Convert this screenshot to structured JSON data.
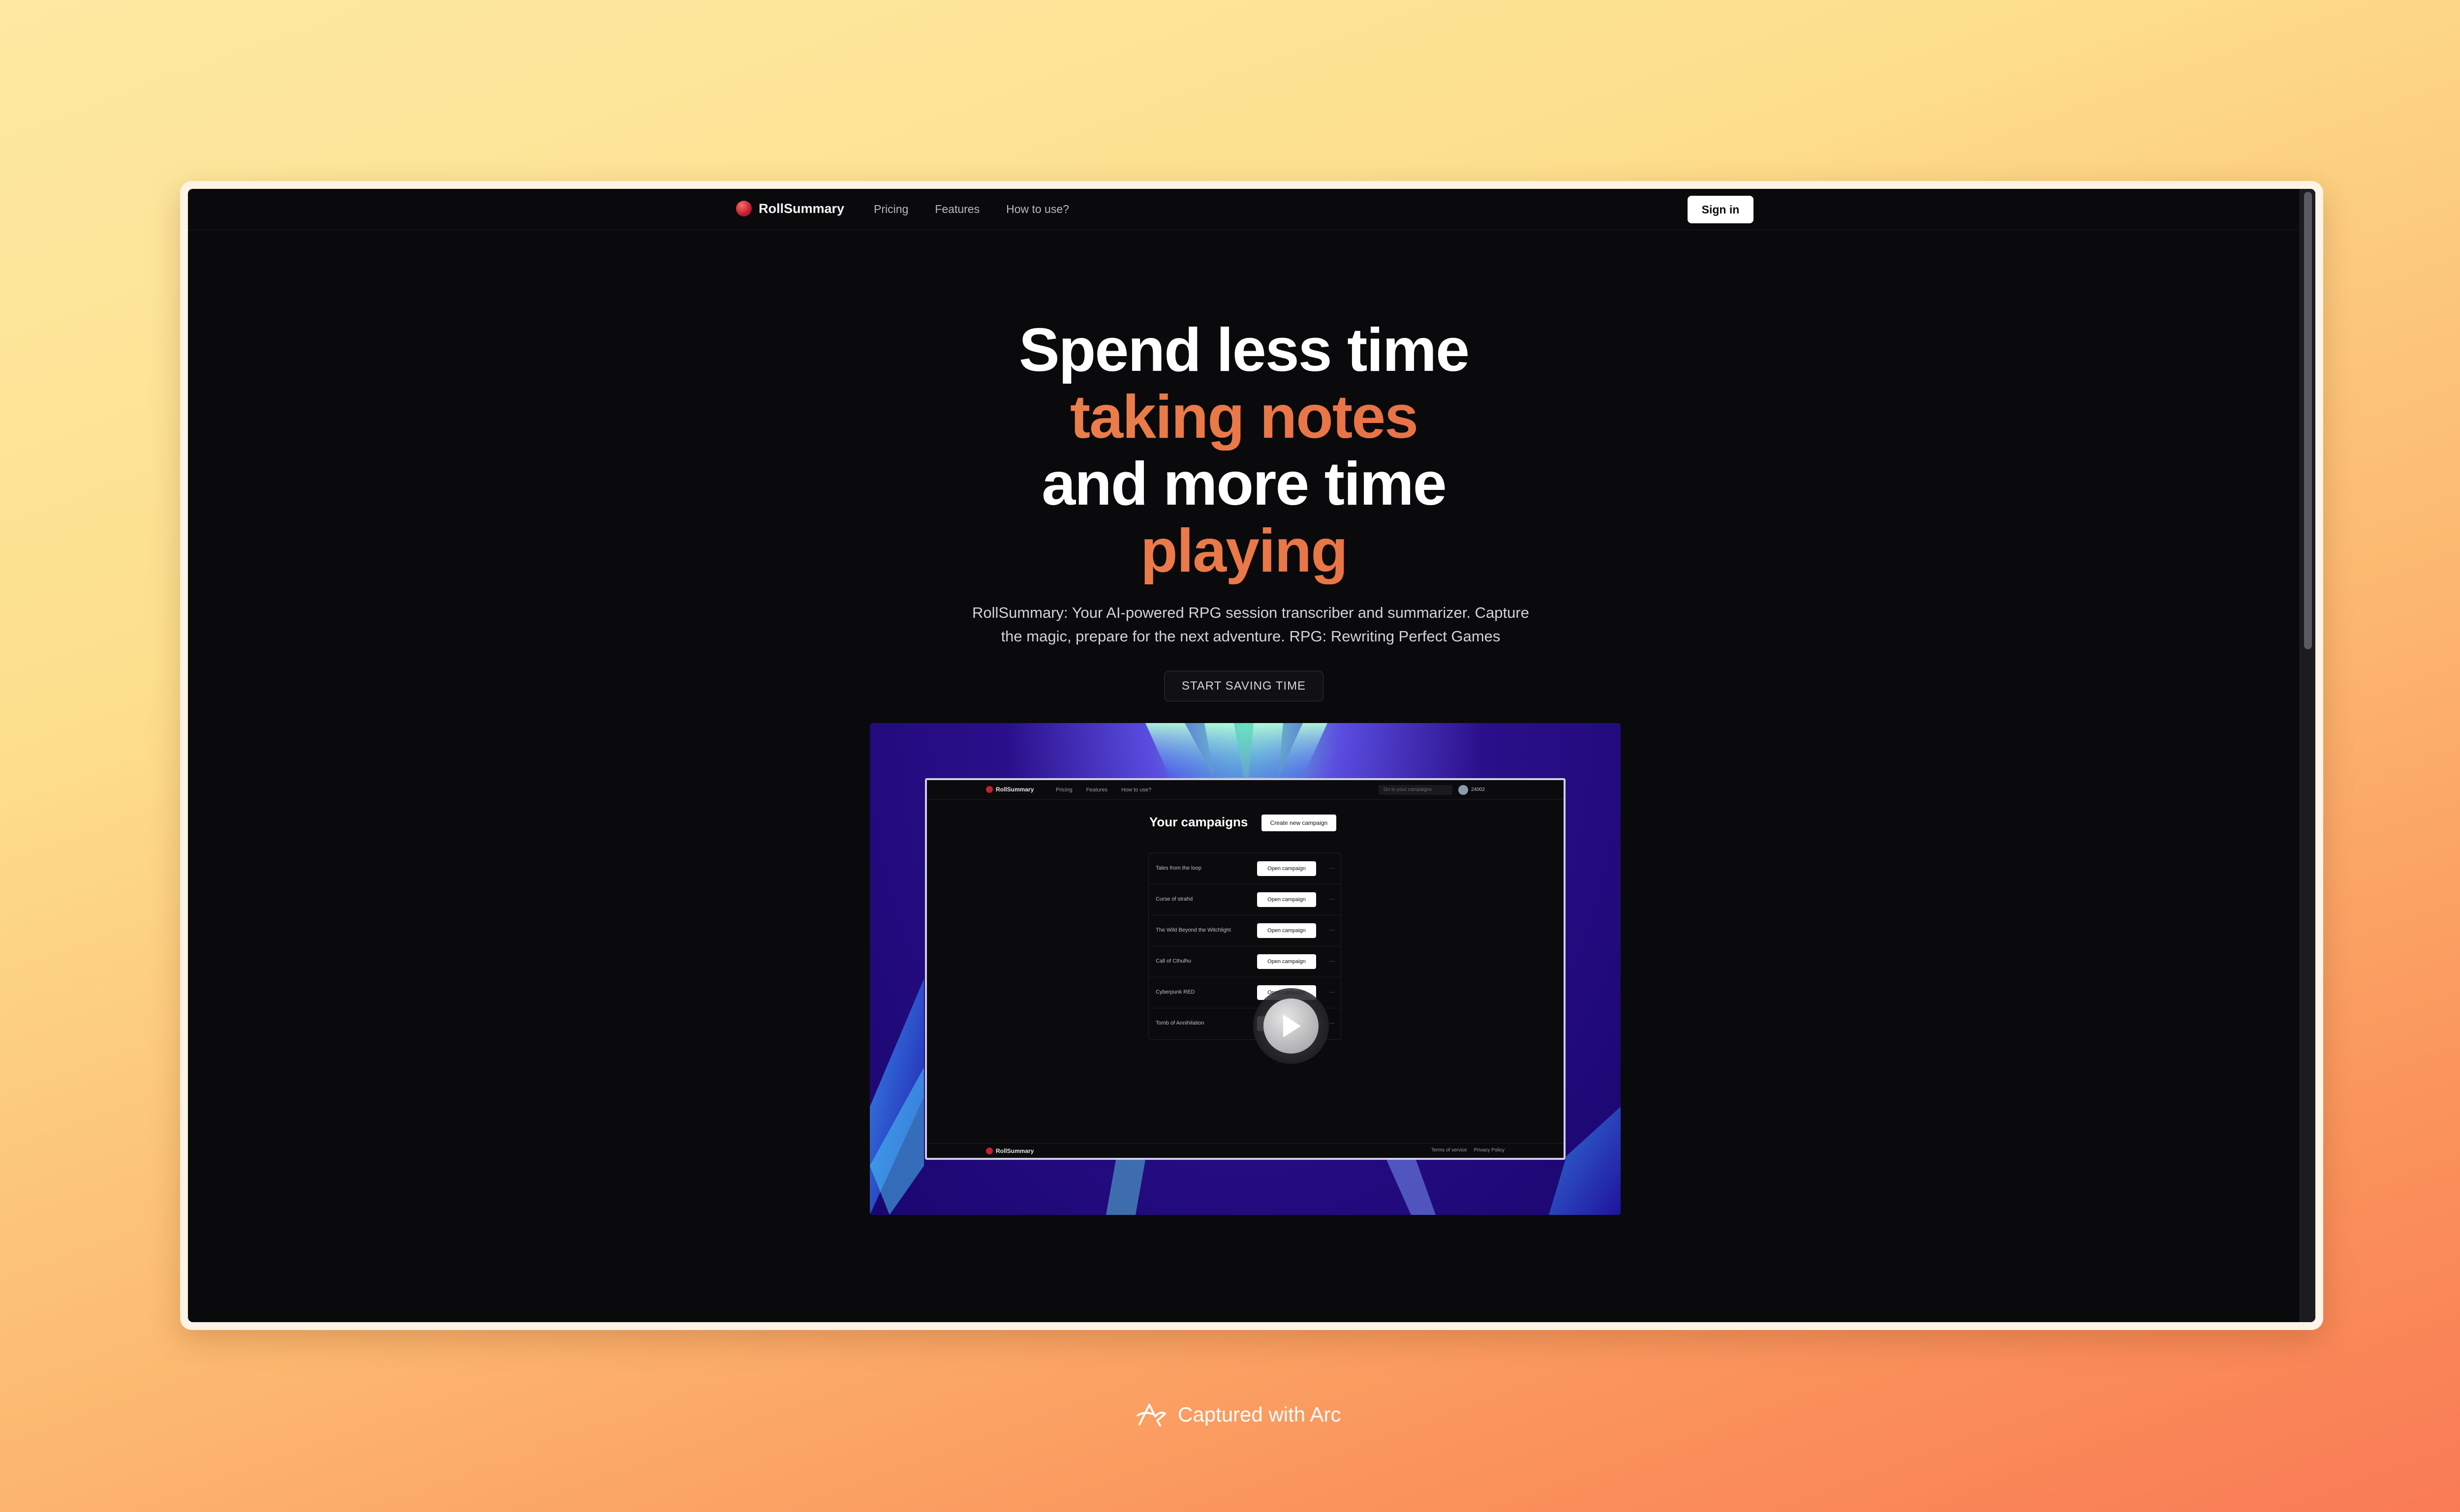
{
  "nav": {
    "brand": "RollSummary",
    "links": [
      "Pricing",
      "Features",
      "How to use?"
    ],
    "signin_label": "Sign in"
  },
  "hero": {
    "line1": "Spend less time",
    "line2": "taking notes",
    "line3": "and more time",
    "line4": "playing",
    "subtitle_1": "RollSummary: Your AI-powered RPG session transcriber and summarizer. Capture",
    "subtitle_2": "the magic, prepare for the next adventure. RPG: Rewriting Perfect Games",
    "cta_label": "START SAVING TIME"
  },
  "preview": {
    "brand": "RollSummary",
    "links": [
      "Pricing",
      "Features",
      "How to use?"
    ],
    "search_placeholder": "Go to your campaigns",
    "credits": "24002",
    "title": "Your campaigns",
    "create_label": "Create new campaign",
    "open_label": "Open campaign",
    "campaigns": [
      "Tales from the loop",
      "Curse of strahd",
      "The Wild Beyond the Witchlight",
      "Call of Cthulhu",
      "Cyberpunk RED",
      "Tomb of Annihilation"
    ],
    "footer_links": [
      "Terms of service",
      "Privacy Policy"
    ]
  },
  "caption": "Captured with Arc",
  "colors": {
    "accent_start": "#f29a55",
    "accent_end": "#e1563b",
    "background": "#0a0a0c"
  }
}
